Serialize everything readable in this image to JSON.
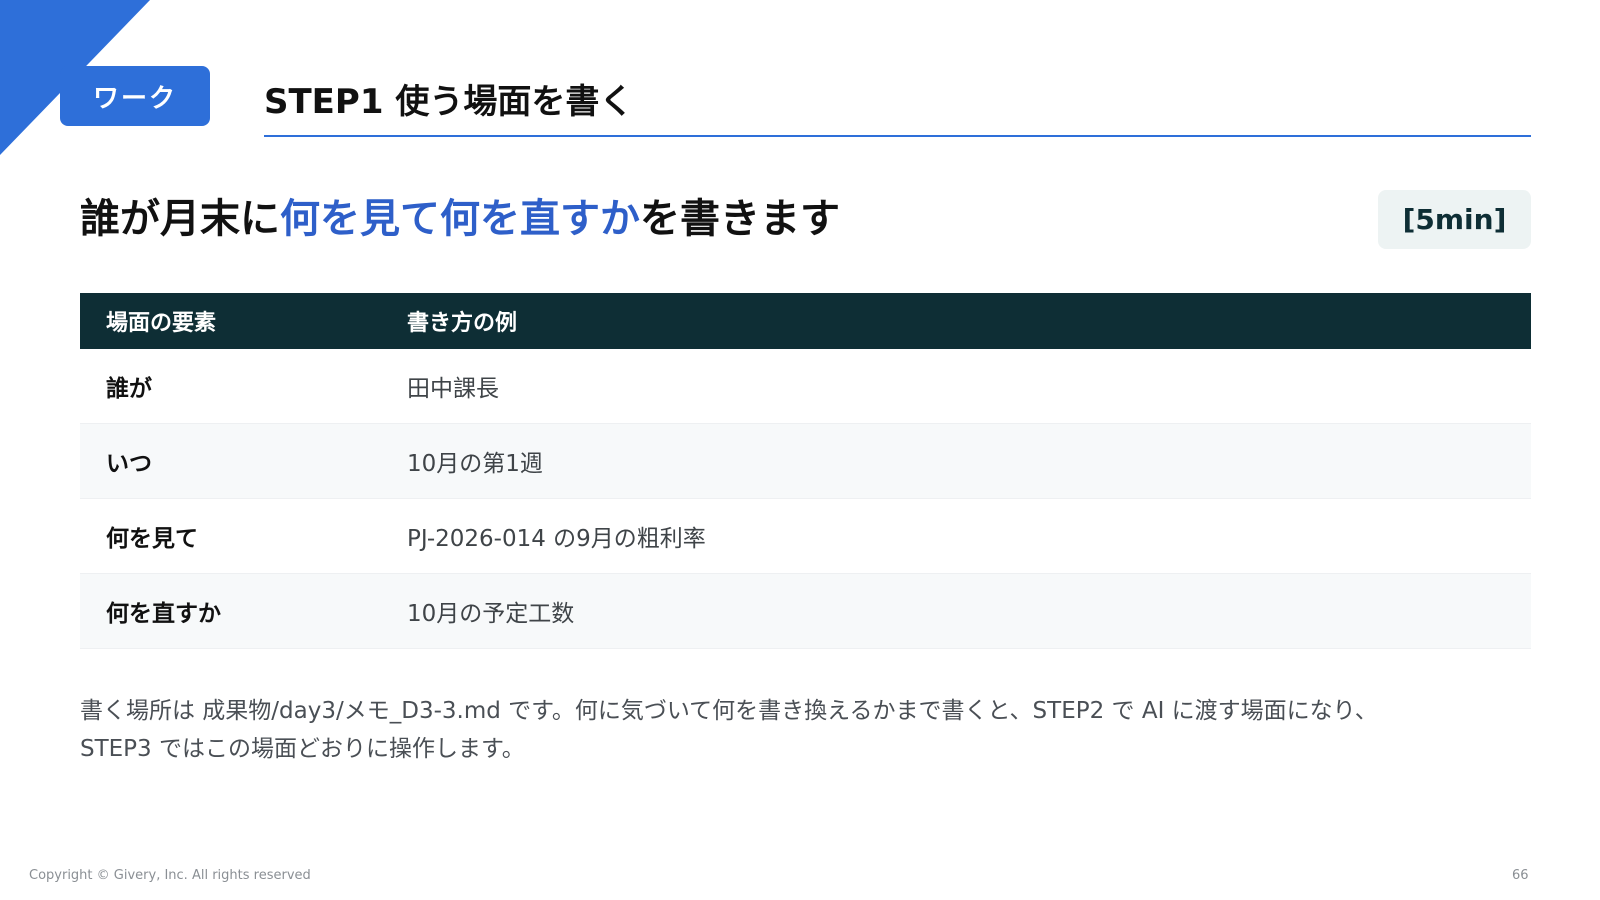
{
  "header": {
    "badge_label": "ワーク",
    "step_title": "STEP1 使う場面を書く"
  },
  "headline": {
    "prefix": "誰が月末に",
    "highlight": "何を見て何を直すか",
    "suffix": "を書きます"
  },
  "time_label": "[5min]",
  "table": {
    "headers": [
      "場面の要素",
      "書き方の例"
    ],
    "rows": [
      {
        "element": "誰が",
        "example": "田中課長"
      },
      {
        "element": "いつ",
        "example": "10月の第1週"
      },
      {
        "element": "何を見て",
        "example": "PJ-2026-014 の9月の粗利率"
      },
      {
        "element": "何を直すか",
        "example": "10月の予定工数"
      }
    ]
  },
  "note": "書く場所は 成果物/day3/メモ_D3-3.md です。何に気づいて何を書き換えるかまで書くと、STEP2 で AI に渡す場面になり、STEP3 ではこの場面どおりに操作します。",
  "footer": {
    "copyright": "Copyright © Givery, Inc. All rights reserved",
    "page_number": "66"
  },
  "colors": {
    "accent_blue": "#2e6fd9",
    "table_header": "#0e2e35"
  }
}
